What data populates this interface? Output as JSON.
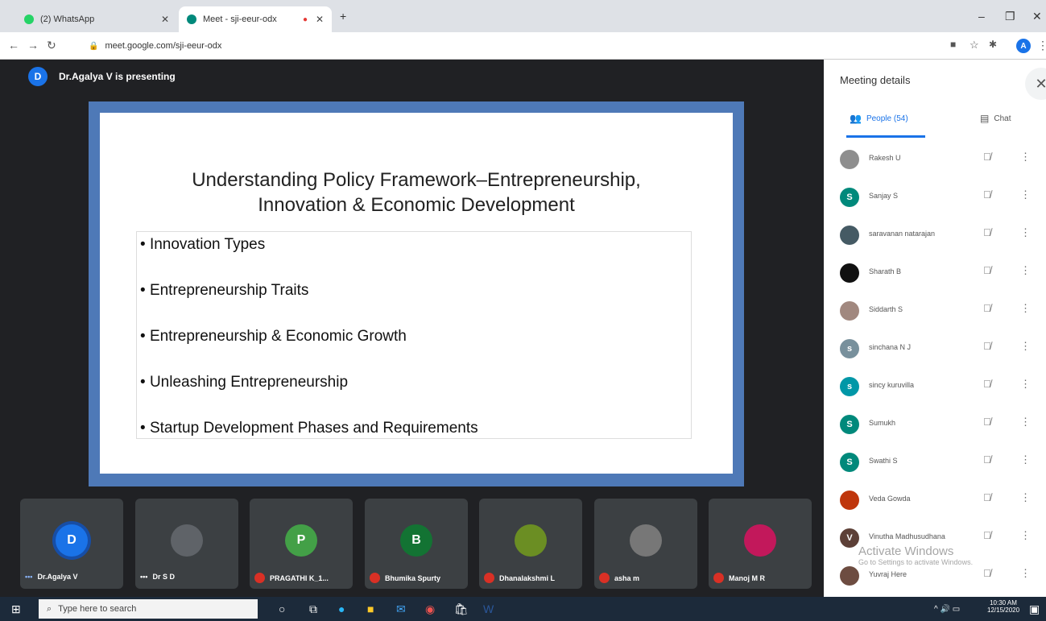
{
  "browser": {
    "tabs": [
      {
        "title": "(2) WhatsApp",
        "fav_color": "#25d366"
      },
      {
        "title": "Meet - sji-eeur-odx",
        "fav_color": "#00897b"
      }
    ],
    "new_tab": "+",
    "url": "meet.google.com/sji-eeur-odx",
    "profile_initial": "A"
  },
  "meet": {
    "presenter_initial": "D",
    "presenter_text": "Dr.Agalya V is presenting",
    "slide": {
      "title_line1": "Understanding Policy Framework–Entrepreneurship,",
      "title_line2": "Innovation & Economic Development",
      "bullets": [
        "Innovation Types",
        "Entrepreneurship Traits",
        "Entrepreneurship & Economic Growth",
        "Unleashing Entrepreneurship",
        "Startup Development Phases and Requirements"
      ]
    },
    "tiles": [
      {
        "name": "Dr.Agalya V",
        "initial": "D",
        "color": "#1a73e8"
      },
      {
        "name": "Dr S D",
        "initial": "",
        "color": "#5f6368"
      },
      {
        "name": "PRAGATHI K_1...",
        "initial": "P",
        "color": "#43a047"
      },
      {
        "name": "Bhumika Spurty",
        "initial": "B",
        "color": "#137333"
      },
      {
        "name": "Dhanalakshmi L",
        "initial": "",
        "color": "#6b8e23"
      },
      {
        "name": "asha m",
        "initial": "",
        "color": "#777777"
      },
      {
        "name": "Manoj M R",
        "initial": "",
        "color": "#c2185b"
      }
    ]
  },
  "panel": {
    "title": "Meeting details",
    "tab_people": "People (54)",
    "tab_chat": "Chat",
    "people": [
      {
        "name": "Rakesh U",
        "initial": "",
        "color": "#8e8e8e"
      },
      {
        "name": "Sanjay S",
        "initial": "S",
        "color": "#00897b"
      },
      {
        "name": "saravanan natarajan",
        "initial": "",
        "color": "#455a64"
      },
      {
        "name": "Sharath B",
        "initial": "",
        "color": "#111111"
      },
      {
        "name": "Siddarth S",
        "initial": "",
        "color": "#a1887f"
      },
      {
        "name": "sinchana N J",
        "initial": "s",
        "color": "#78909c"
      },
      {
        "name": "sincy kuruvilla",
        "initial": "s",
        "color": "#0097a7"
      },
      {
        "name": "Sumukh",
        "initial": "S",
        "color": "#00897b"
      },
      {
        "name": "Swathi S",
        "initial": "S",
        "color": "#00897b"
      },
      {
        "name": "Veda Gowda",
        "initial": "",
        "color": "#bf360c"
      },
      {
        "name": "Vinutha Madhusudhana",
        "initial": "V",
        "color": "#5d4037"
      },
      {
        "name": "Yuvraj Here",
        "initial": "",
        "color": "#6d4c41"
      }
    ],
    "watermark_title": "Activate Windows",
    "watermark_sub": "Go to Settings to activate Windows."
  },
  "taskbar": {
    "search_placeholder": "Type here to search",
    "time": "10:30 AM",
    "date": "12/15/2020"
  },
  "colors": {
    "accent": "#1a73e8",
    "slide_border": "#4e79b7",
    "meet_bg": "#202124"
  }
}
